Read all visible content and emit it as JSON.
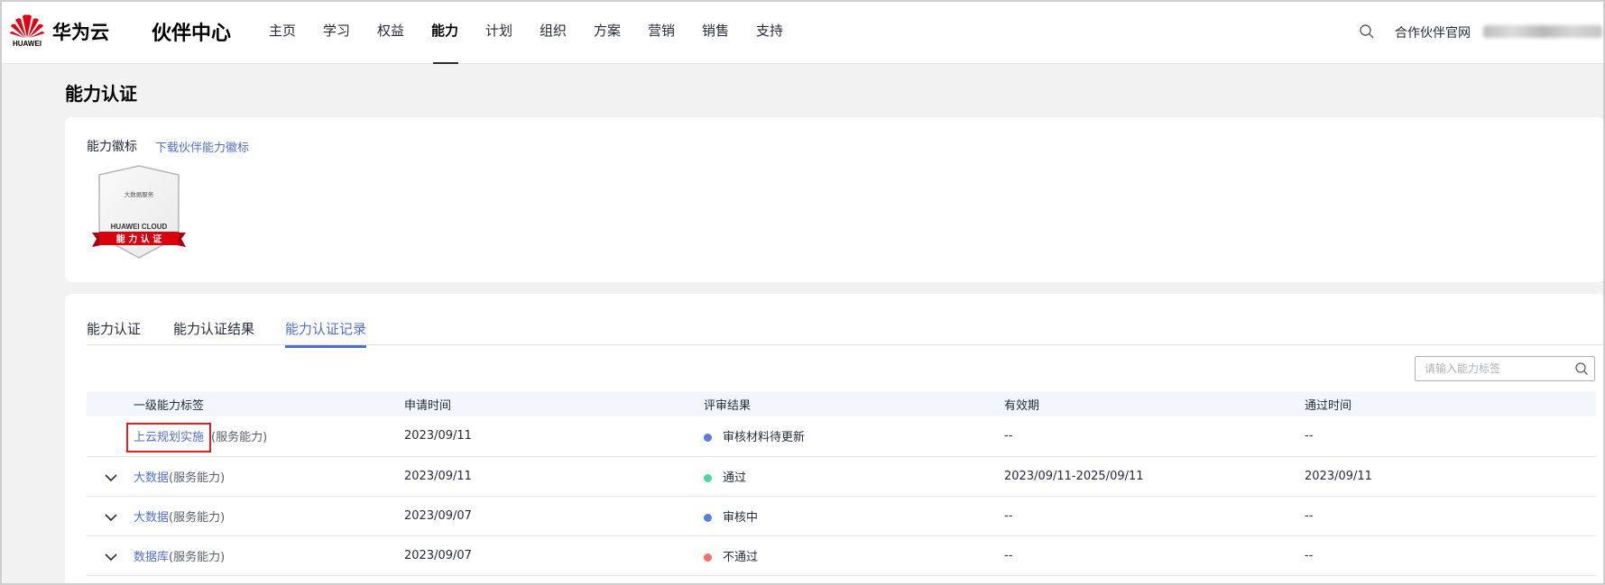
{
  "header": {
    "logo_text": "HUAWEI",
    "brand": "华为云",
    "site_title": "伙伴中心",
    "nav": [
      {
        "label": "主页",
        "active": false
      },
      {
        "label": "学习",
        "active": false
      },
      {
        "label": "权益",
        "active": false
      },
      {
        "label": "能力",
        "active": true
      },
      {
        "label": "计划",
        "active": false
      },
      {
        "label": "组织",
        "active": false
      },
      {
        "label": "方案",
        "active": false
      },
      {
        "label": "营销",
        "active": false
      },
      {
        "label": "销售",
        "active": false
      },
      {
        "label": "支持",
        "active": false
      }
    ],
    "partner_link": "合作伙伴官网"
  },
  "page_title": "能力认证",
  "badge_section": {
    "label": "能力徽标",
    "download_link": "下载伙伴能力徽标",
    "badge": {
      "top_text": "大数据服务",
      "cloud_text": "HUAWEI CLOUD",
      "ribbon_text": "能 力 认 证"
    }
  },
  "tabs": [
    {
      "label": "能力认证",
      "active": false
    },
    {
      "label": "能力认证结果",
      "active": false
    },
    {
      "label": "能力认证记录",
      "active": true
    }
  ],
  "search": {
    "placeholder": "请输入能力标签",
    "value": ""
  },
  "table": {
    "headers": [
      "一级能力标签",
      "申请时间",
      "评审结果",
      "有效期",
      "通过时间"
    ],
    "rows": [
      {
        "label": "上云规划实施",
        "suffix": "(服务能力)",
        "expandable": false,
        "highlighted": true,
        "apply_date": "2023/09/11",
        "result": "审核材料待更新",
        "result_color": "#5e7ce0",
        "validity": "--",
        "pass_date": "--"
      },
      {
        "label": "大数据",
        "suffix": "(服务能力)",
        "expandable": true,
        "highlighted": false,
        "apply_date": "2023/09/11",
        "result": "通过",
        "result_color": "#50d4ab",
        "validity": "2023/09/11-2025/09/11",
        "pass_date": "2023/09/11"
      },
      {
        "label": "大数据",
        "suffix": "(服务能力)",
        "expandable": true,
        "highlighted": false,
        "apply_date": "2023/09/07",
        "result": "审核中",
        "result_color": "#5e7ce0",
        "validity": "--",
        "pass_date": "--"
      },
      {
        "label": "数据库",
        "suffix": "(服务能力)",
        "expandable": true,
        "highlighted": false,
        "apply_date": "2023/09/07",
        "result": "不通过",
        "result_color": "#f66f6a",
        "validity": "--",
        "pass_date": "--"
      }
    ]
  }
}
